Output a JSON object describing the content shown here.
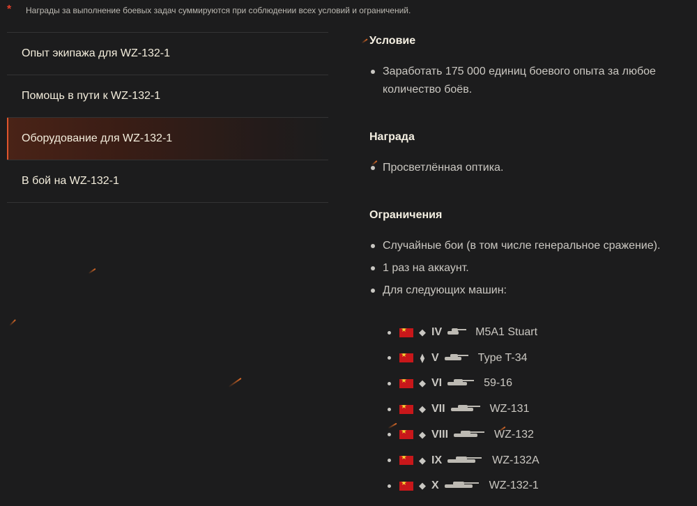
{
  "note": {
    "star": "*",
    "text": "Награды за выполнение боевых задач суммируются при соблюдении всех условий и ограничений."
  },
  "menu": [
    {
      "label": "Опыт экипажа для WZ-132-1"
    },
    {
      "label": "Помощь в пути к WZ-132-1"
    },
    {
      "label": "Оборудование для WZ-132-1",
      "active": true
    },
    {
      "label": "В бой на WZ-132-1"
    }
  ],
  "condition": {
    "title": "Условие",
    "items": [
      "Заработать 175 000 единиц боевого опыта за любое количество боёв."
    ]
  },
  "reward": {
    "title": "Награда",
    "items": [
      "Просветлённая оптика."
    ]
  },
  "limits": {
    "title": "Ограничения",
    "items": [
      "Случайные бои (в том числе генеральное сражение).",
      "1 раз на аккаунт.",
      "Для следующих машин:"
    ]
  },
  "vehicles": [
    {
      "tier": "IV",
      "name": "M5A1 Stuart",
      "class_icon": "light-tank-icon",
      "nation_icon": "china-flag-icon"
    },
    {
      "tier": "V",
      "name": "Type T-34",
      "class_icon": "medium-tank-icon",
      "nation_icon": "china-flag-icon"
    },
    {
      "tier": "VI",
      "name": "59-16",
      "class_icon": "light-tank-icon",
      "nation_icon": "china-flag-icon"
    },
    {
      "tier": "VII",
      "name": "WZ-131",
      "class_icon": "light-tank-icon",
      "nation_icon": "china-flag-icon"
    },
    {
      "tier": "VIII",
      "name": "WZ-132",
      "class_icon": "light-tank-icon",
      "nation_icon": "china-flag-icon"
    },
    {
      "tier": "IX",
      "name": "WZ-132A",
      "class_icon": "light-tank-icon",
      "nation_icon": "china-flag-icon"
    },
    {
      "tier": "X",
      "name": "WZ-132-1",
      "class_icon": "light-tank-icon",
      "nation_icon": "china-flag-icon"
    }
  ],
  "colors": {
    "accent": "#e0552c",
    "background": "#1c1c1d",
    "heading": "#f4efe2"
  }
}
